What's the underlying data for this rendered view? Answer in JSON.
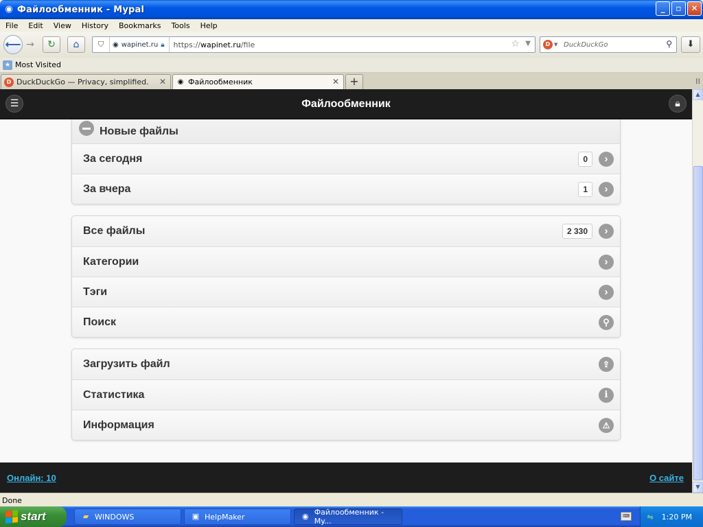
{
  "window": {
    "title": "Файлообменник - Mypal",
    "icon": "mypal-eye-icon",
    "controls": {
      "minimize": "_",
      "maximize": "▫",
      "close": "✕"
    }
  },
  "menu": [
    "File",
    "Edit",
    "View",
    "History",
    "Bookmarks",
    "Tools",
    "Help"
  ],
  "nav": {
    "site_identity": "wapinet.ru",
    "url_prefix": "https://",
    "url_domain": "wapinet.ru",
    "url_path": "/file",
    "search_placeholder": "DuckDuckGo"
  },
  "bookmarks": {
    "most_visited": "Most Visited"
  },
  "tabs": [
    {
      "label": "DuckDuckGo — Privacy, simplified.",
      "active": false
    },
    {
      "label": "Файлообменник",
      "active": true
    }
  ],
  "site": {
    "header_title": "Файлообменник",
    "new_files": {
      "heading": "Новые файлы",
      "rows": [
        {
          "label": "За сегодня",
          "count": "0"
        },
        {
          "label": "За вчера",
          "count": "1"
        }
      ]
    },
    "browse": [
      {
        "label": "Все файлы",
        "count": "2 330",
        "icon": "arrow-right-icon"
      },
      {
        "label": "Категории",
        "icon": "arrow-right-icon"
      },
      {
        "label": "Тэги",
        "icon": "arrow-right-icon"
      },
      {
        "label": "Поиск",
        "icon": "search-icon"
      }
    ],
    "actions": [
      {
        "label": "Загрузить файл",
        "icon": "upload-icon"
      },
      {
        "label": "Статистика",
        "icon": "info-icon"
      },
      {
        "label": "Информация",
        "icon": "alert-icon"
      }
    ],
    "footer_online": "Онлайн: 10",
    "footer_about": "О сайте"
  },
  "status": "Done",
  "taskbar": {
    "start": "start",
    "tasks": [
      {
        "label": "WINDOWS",
        "icon": "folder-icon",
        "active": false
      },
      {
        "label": "HelpMaker",
        "icon": "helpmaker-icon",
        "active": false
      },
      {
        "label": "Файлообменник - My...",
        "icon": "mypal-eye-icon",
        "active": true
      }
    ],
    "clock": "1:20 PM"
  },
  "colors": {
    "site_header_bg": "#1d1d1d",
    "footer_link": "#3bb4e5",
    "xp_blue": "#245edb",
    "start_green": "#3a8f37"
  }
}
